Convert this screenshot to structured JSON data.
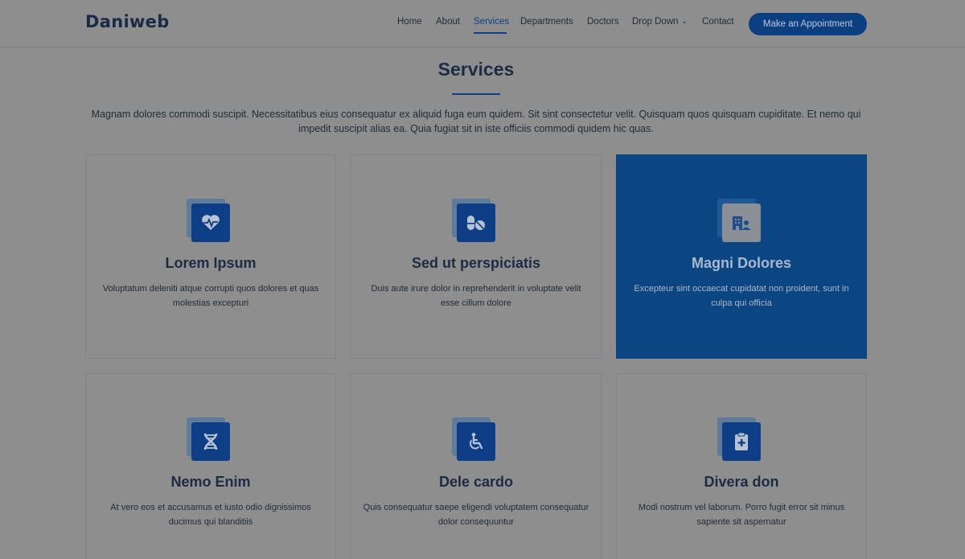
{
  "brand": {
    "logo": "Daniweb"
  },
  "nav": {
    "items": [
      {
        "label": "Home"
      },
      {
        "label": "About"
      },
      {
        "label": "Services",
        "active": true
      },
      {
        "label": "Departments"
      },
      {
        "label": "Doctors"
      },
      {
        "label": "Drop Down"
      },
      {
        "label": "Contact"
      }
    ],
    "cta_label": "Make an Appointment"
  },
  "services": {
    "title": "Services",
    "intro": "Magnam dolores commodi suscipit. Necessitatibus eius consequatur ex aliquid fuga eum quidem. Sit sint consectetur velit. Quisquam quos quisquam cupiditate. Et nemo qui impedit suscipit alias ea. Quia fugiat sit in iste officiis commodi quidem hic quas.",
    "cards": [
      {
        "title": "Lorem Ipsum",
        "desc": "Voluptatum deleniti atque corrupti quos dolores et quas molestias excepturi",
        "icon": "heart-pulse-icon"
      },
      {
        "title": "Sed ut perspiciatis",
        "desc": "Duis aute irure dolor in reprehenderit in voluptate velit esse cillum dolore",
        "icon": "capsule-pill-icon"
      },
      {
        "title": "Magni Dolores",
        "desc": "Excepteur sint occaecat cupidatat non proident, sunt in culpa qui officia",
        "icon": "hospital-user-icon",
        "featured": true
      },
      {
        "title": "Nemo Enim",
        "desc": "At vero eos et accusamus et iusto odio dignissimos ducimus qui blanditiis",
        "icon": "dna-icon"
      },
      {
        "title": "Dele cardo",
        "desc": "Quis consequatur saepe eligendi voluptatem consequatur dolor consequuntur",
        "icon": "wheelchair-icon"
      },
      {
        "title": "Divera don",
        "desc": "Modi nostrum vel laborum. Porro fugit error sit minus sapiente sit aspernatur",
        "icon": "clipboard-medical-icon"
      }
    ]
  },
  "colors": {
    "accent": "#0d3e86",
    "overlay_bg": "#8e8e8e",
    "featured_bg": "#0c4682"
  }
}
